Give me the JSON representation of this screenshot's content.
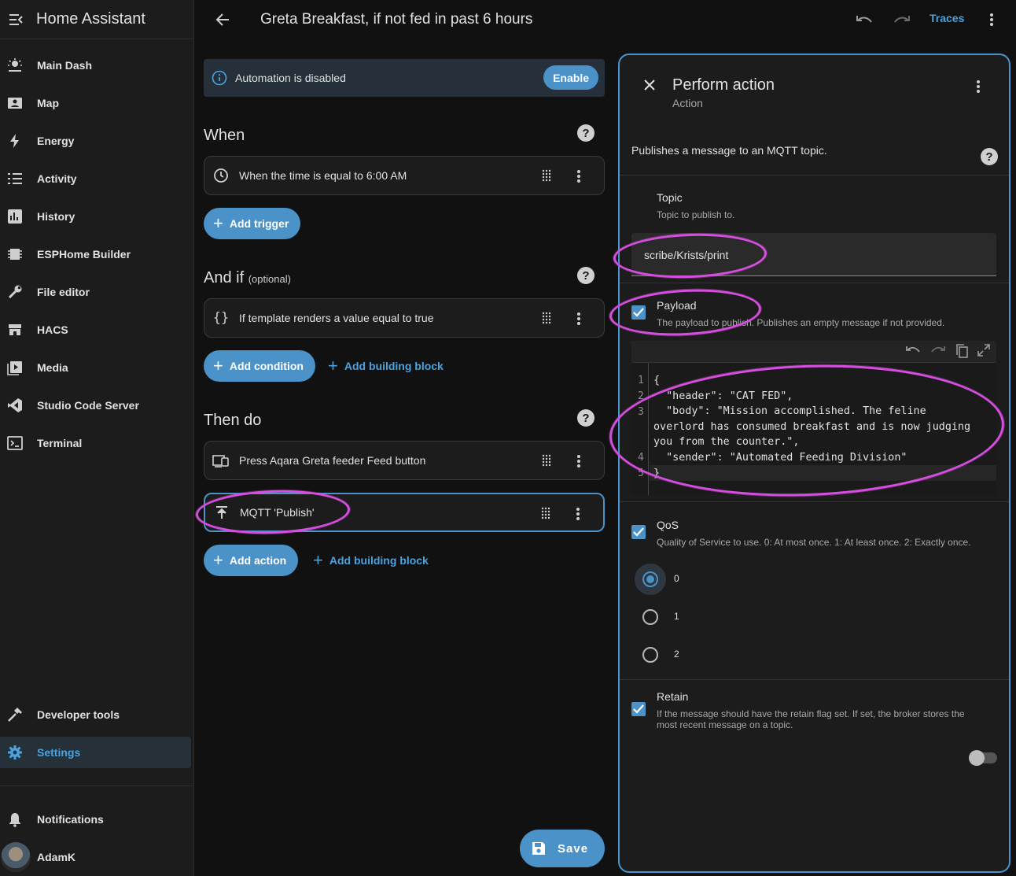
{
  "app": {
    "title": "Home Assistant"
  },
  "sidebar": {
    "items": [
      {
        "label": "Main Dash",
        "icon": "dashboard-icon"
      },
      {
        "label": "Map",
        "icon": "map-icon"
      },
      {
        "label": "Energy",
        "icon": "lightning-icon"
      },
      {
        "label": "Activity",
        "icon": "list-icon"
      },
      {
        "label": "History",
        "icon": "chart-icon"
      },
      {
        "label": "ESPHome Builder",
        "icon": "chip-icon"
      },
      {
        "label": "File editor",
        "icon": "wrench-icon"
      },
      {
        "label": "HACS",
        "icon": "hacs-icon"
      },
      {
        "label": "Media",
        "icon": "media-icon"
      },
      {
        "label": "Studio Code Server",
        "icon": "vscode-icon"
      },
      {
        "label": "Terminal",
        "icon": "terminal-icon"
      }
    ],
    "developer_tools": "Developer tools",
    "settings": "Settings",
    "notifications": "Notifications",
    "user": "AdamK"
  },
  "topbar": {
    "title": "Greta Breakfast, if not fed in past 6 hours",
    "traces": "Traces"
  },
  "banner": {
    "text": "Automation is disabled",
    "enable": "Enable"
  },
  "when": {
    "title": "When",
    "trigger": "When the time is equal to 6:00 AM",
    "add": "Add trigger"
  },
  "and_if": {
    "title": "And if",
    "optional": "(optional)",
    "condition": "If template renders a value equal to true",
    "add": "Add condition",
    "building_block": "Add building block"
  },
  "then_do": {
    "title": "Then do",
    "action1": "Press Aqara Greta feeder Feed button",
    "action2": "MQTT 'Publish'",
    "add": "Add action",
    "building_block": "Add building block"
  },
  "save": "Save",
  "panel": {
    "title": "Perform action",
    "subtitle": "Action",
    "description": "Publishes a message to an MQTT topic.",
    "topic": {
      "label": "Topic",
      "help": "Topic to publish to.",
      "value": "scribe/Krists/print"
    },
    "payload": {
      "label": "Payload",
      "help": "The payload to publish. Publishes an empty message if not provided."
    },
    "code_lines": [
      {
        "n": "1",
        "text": "{"
      },
      {
        "n": "2",
        "text": "  \"header\": \"CAT FED\","
      },
      {
        "n": "3",
        "text": "  \"body\": \"Mission accomplished. The feline"
      },
      {
        "n": "",
        "text": "overlord has consumed breakfast and is now judging"
      },
      {
        "n": "",
        "text": "you from the counter.\","
      },
      {
        "n": "4",
        "text": "  \"sender\": \"Automated Feeding Division\""
      },
      {
        "n": "5",
        "text": "}"
      }
    ],
    "qos": {
      "label": "QoS",
      "help": "Quality of Service to use. 0: At most once. 1: At least once. 2: Exactly once.",
      "options": [
        "0",
        "1",
        "2"
      ],
      "selected": "0"
    },
    "retain": {
      "label": "Retain",
      "help1": "If the message should have the retain flag set. If set, the broker stores the",
      "help2": "most recent message on a topic."
    }
  },
  "colors": {
    "accent": "#4a92c8",
    "highlight": "#d64ee0"
  }
}
